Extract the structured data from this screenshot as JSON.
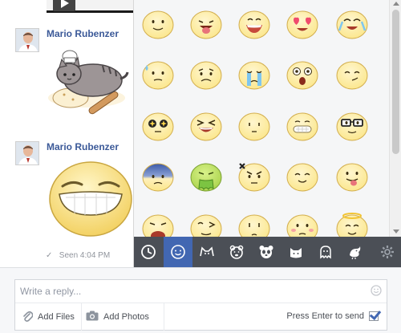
{
  "chat": {
    "messages": [
      {
        "sender": "Mario Rubenzer",
        "avatar_icon": "avatar",
        "sticker": "pusheen-baker-sticker"
      },
      {
        "sender": "Mario Rubenzer",
        "avatar_icon": "avatar",
        "sticker": "big-grin-emoji-sticker"
      }
    ],
    "seen_text": "Seen 4:04 PM",
    "seen_icon": "checkmark-icon"
  },
  "sticker_panel": {
    "stickers": [
      "smile-sticker",
      "tongue-out-sticker",
      "grin-sticker",
      "heart-eyes-sticker",
      "happy-cry-sticker",
      "sweat-sticker",
      "sad-sticker",
      "crying-sticker",
      "shocked-sticker",
      "wink-smirk-sticker",
      "star-eyes-sticker",
      "squint-laugh-sticker",
      "blank-sticker",
      "grimace-sticker",
      "nerd-glasses-sticker",
      "scared-blue-sticker",
      "sick-green-sticker",
      "angry-sticker",
      "content-sticker",
      "cheeky-sticker",
      "shout-sticker",
      "wink-sticker",
      "pout-sticker",
      "blush-sticker",
      "angel-sticker"
    ],
    "toolbar": [
      {
        "icon": "clock-icon",
        "active": false
      },
      {
        "icon": "smiley-face-icon",
        "active": true
      },
      {
        "icon": "cat-face-icon",
        "active": false
      },
      {
        "icon": "bear-face-icon",
        "active": false
      },
      {
        "icon": "panda-face-icon",
        "active": false
      },
      {
        "icon": "white-cat-icon",
        "active": false
      },
      {
        "icon": "ghost-icon",
        "active": false
      },
      {
        "icon": "bird-icon",
        "active": false
      },
      {
        "icon": "gear-icon",
        "active": false
      }
    ]
  },
  "composer": {
    "placeholder": "Write a reply...",
    "add_files_label": "Add Files",
    "add_photos_label": "Add Photos",
    "enter_hint": "Press Enter to send",
    "enter_checked": true
  },
  "colors": {
    "sender_name": "#3b5998",
    "toolbar_bg": "#4b4f56",
    "toolbar_active": "#4267b2",
    "sticker_face": "#fbe68a"
  }
}
